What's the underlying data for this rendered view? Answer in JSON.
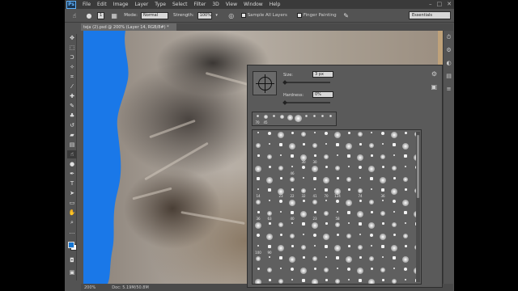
{
  "menubar": {
    "logo": "Ps",
    "items": [
      "File",
      "Edit",
      "Image",
      "Layer",
      "Type",
      "Select",
      "Filter",
      "3D",
      "View",
      "Window",
      "Help"
    ]
  },
  "options": {
    "brush_size": "1",
    "mode_label": "Mode:",
    "mode_value": "Normal",
    "strength_label": "Strength:",
    "strength_value": "100%",
    "sample_all_layers": "Sample All Layers",
    "finger_painting": "Finger Painting",
    "workspace": "Essentials"
  },
  "document_tab": "teja (2).psd @ 200% (Layer 14, RGB/8#) *",
  "status": {
    "zoom": "200%",
    "doc": "Doc: 5.19M/50.8M"
  },
  "brush_panel": {
    "size_label": "Size:",
    "size_value": "3 px",
    "hardness_label": "Hardness:",
    "hardness_value": "0%",
    "recent_sizes": [
      "70",
      "45",
      "",
      "",
      "",
      "",
      "",
      "",
      "",
      ""
    ],
    "brush_numbers": [
      "",
      "",
      "",
      "",
      "",
      "",
      "",
      "",
      "",
      "",
      "",
      "",
      "",
      "",
      "",
      "",
      "",
      "",
      "",
      "",
      "",
      "",
      "",
      "",
      "",
      "",
      "",
      "",
      "",
      "",
      "",
      "",
      "",
      "",
      "30",
      "30",
      "",
      "",
      "",
      "",
      "",
      "",
      "",
      "",
      "",
      "",
      "",
      "",
      "46",
      "",
      "",
      "",
      "",
      "",
      "",
      "",
      "",
      "",
      "",
      "",
      "",
      "",
      "",
      "",
      "",
      "",
      "",
      "",
      "",
      "",
      "",
      "",
      "",
      "",
      "",
      "14",
      "",
      "23",
      "22",
      "32",
      "41",
      "70",
      "124",
      "",
      "74",
      "",
      "36",
      "",
      "",
      "",
      "",
      "",
      "",
      "",
      "",
      "",
      "",
      "",
      "",
      "",
      "",
      "",
      "",
      "",
      "",
      "36",
      "63",
      "",
      "40",
      "",
      "23",
      "",
      "58",
      "",
      "",
      "",
      "",
      "",
      "",
      "",
      "",
      "",
      "",
      "",
      "",
      "",
      "",
      "",
      "",
      "",
      "",
      "",
      "",
      "",
      "",
      "",
      "",
      "",
      "",
      "",
      "",
      "",
      "",
      "",
      "",
      "",
      "",
      "",
      "",
      "",
      "100",
      "90",
      "",
      "",
      "",
      "",
      "",
      "",
      "",
      "",
      "",
      "",
      "",
      "",
      "",
      "",
      "",
      "",
      "",
      "",
      "",
      "",
      "",
      "",
      "",
      "",
      "",
      "",
      "",
      "",
      "",
      "",
      "",
      "",
      "",
      "",
      "",
      "",
      "",
      "",
      "",
      "",
      "",
      "",
      "",
      "",
      "",
      "",
      "",
      "",
      "",
      "",
      "",
      "",
      "",
      "",
      "",
      "",
      "",
      ""
    ]
  },
  "colors": {
    "foreground": "#1475d2",
    "background": "#ffffff",
    "canvas_backdrop": "#1a78e8"
  }
}
